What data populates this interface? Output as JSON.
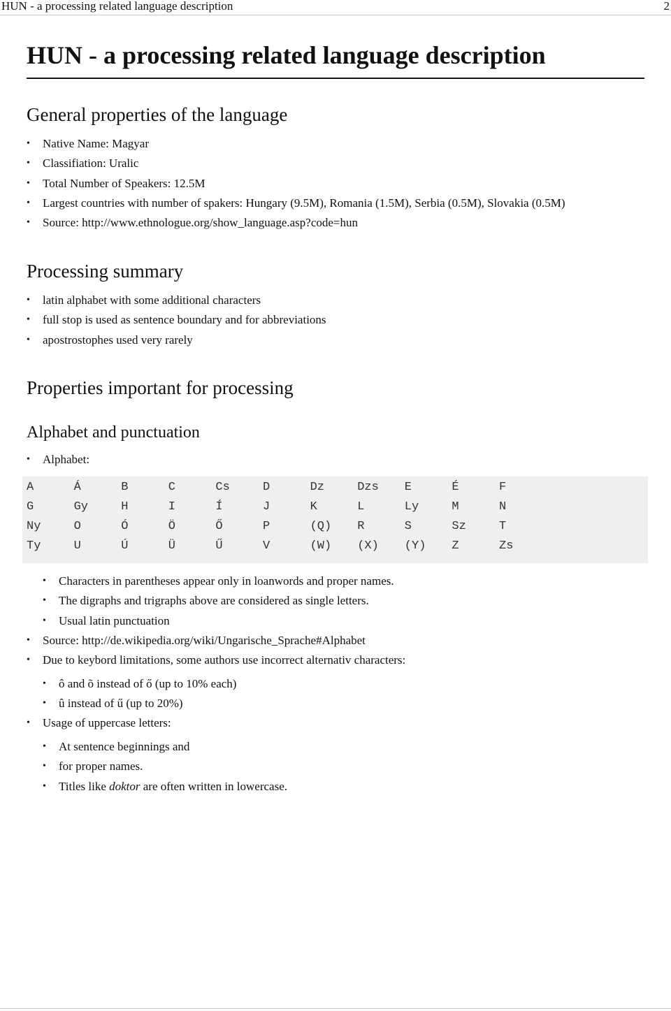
{
  "running_header": {
    "title": "HUN - a processing related language description",
    "page_number": "2"
  },
  "title": "HUN - a processing related language description",
  "general": {
    "heading": "General properties of the language",
    "items": [
      "Native Name: Magyar",
      "Classifiation: Uralic",
      "Total Number of Speakers: 12.5M",
      "Largest countries with number of spakers: Hungary (9.5M), Romania (1.5M), Serbia (0.5M), Slovakia (0.5M)",
      "Source: http://www.ethnologue.org/show_language.asp?code=hun"
    ]
  },
  "summary": {
    "heading": "Processing summary",
    "items": [
      "latin alphabet with some additional characters",
      "full stop is used as sentence boundary and for abbreviations",
      "apostrostophes used very rarely"
    ]
  },
  "properties": {
    "heading": "Properties important for processing",
    "alphabet_section": {
      "heading": "Alphabet and punctuation",
      "alphabet_label": "Alphabet:",
      "rows": [
        [
          "A",
          "Á",
          "B",
          "C",
          "Cs",
          "D",
          "Dz",
          "Dzs",
          "E",
          "É",
          "F"
        ],
        [
          "G",
          "Gy",
          "H",
          "I",
          "Í",
          "J",
          "K",
          "L",
          "Ly",
          "M",
          "N"
        ],
        [
          "Ny",
          "O",
          "Ó",
          "Ö",
          "Ő",
          "P",
          "(Q)",
          "R",
          "S",
          "Sz",
          "T"
        ],
        [
          "Ty",
          "U",
          "Ú",
          "Ü",
          "Ű",
          "V",
          "(W)",
          "(X)",
          "(Y)",
          "Z",
          "Zs"
        ]
      ],
      "notes": [
        "Characters in parentheses appear only in loanwords and proper names.",
        "The digraphs and trigraphs above are considered as single letters.",
        "Usual latin punctuation"
      ],
      "source": "Source: http://de.wikipedia.org/wiki/Ungarische_Sprache#Alphabet",
      "keyboard_note": "Due to keybord limitations, some authors use incorrect alternativ characters:",
      "keyboard_items": [
        "ô and õ instead of ő (up to 10% each)",
        "û instead of ű (up to 20%)"
      ],
      "uppercase_label": "Usage of uppercase letters:",
      "uppercase_items": [
        "At sentence beginnings and",
        "for proper names."
      ],
      "titles_item": {
        "prefix": "Titles like ",
        "emph": "doktor",
        "suffix": " are often written in lowercase."
      }
    }
  }
}
